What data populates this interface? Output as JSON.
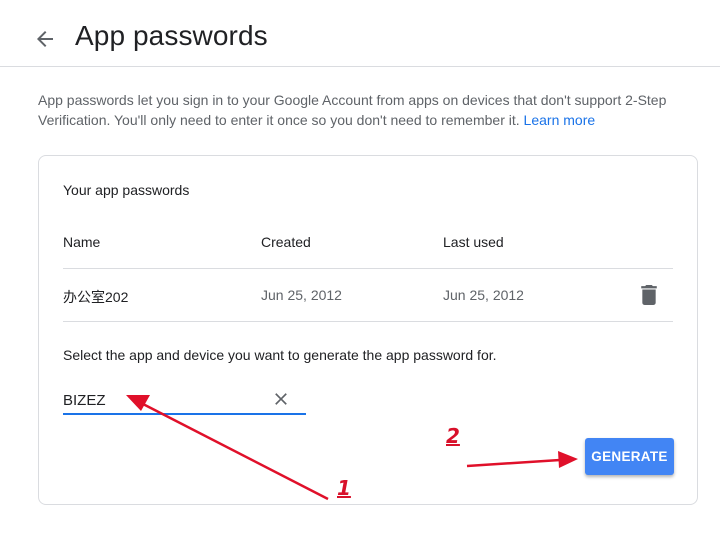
{
  "header": {
    "back_icon": "arrow-left-icon",
    "title": "App passwords"
  },
  "intro": {
    "text": "App passwords let you sign in to your Google Account from apps on devices that don't support 2-Step Verification. You'll only need to enter it once so you don't need to remember it.",
    "link": "Learn more"
  },
  "card": {
    "title": "Your app passwords",
    "columns": {
      "name": "Name",
      "created": "Created",
      "last_used": "Last used"
    },
    "rows": [
      {
        "name": "办公室202",
        "created": "Jun 25, 2012",
        "last_used": "Jun 25, 2012",
        "action_icon": "trash-icon"
      }
    ],
    "select_label": "Select the app and device you want to generate the app password for.",
    "app_field": {
      "value": "BIZEZ",
      "clear_icon": "close-icon"
    },
    "generate_label": "GENERATE"
  },
  "annotations": {
    "marker_1": "1",
    "marker_2": "2",
    "color": "#e0102a"
  },
  "colors": {
    "link": "#1a73e8",
    "button": "#4285f4",
    "input_underline": "#1a73e8",
    "border": "#dadce0"
  }
}
